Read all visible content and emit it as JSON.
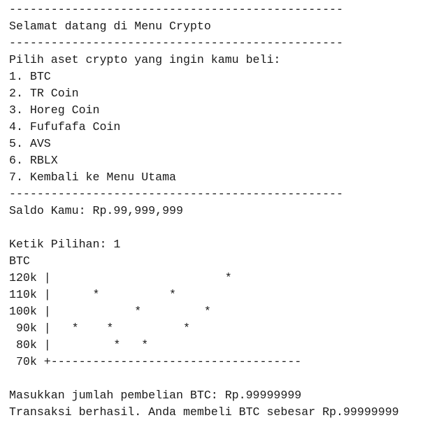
{
  "terminal": {
    "lines": [
      "------------------------------------------------",
      "Selamat datang di Menu Crypto",
      "------------------------------------------------",
      "Pilih aset crypto yang ingin kamu beli:",
      "1. BTC",
      "2. TR Coin",
      "3. Horeg Coin",
      "4. Fufufafa Coin",
      "5. AVS",
      "6. RBLX",
      "7. Kembali ke Menu Utama",
      "------------------------------------------------",
      "Saldo Kamu: Rp.99,999,999",
      "",
      "Ketik Pilihan: 1",
      "BTC",
      "120k |                         *",
      "110k |      *          *",
      "100k |            *         *",
      " 90k |   *    *          *",
      " 80k |         *   *",
      " 70k +------------------------------------",
      "",
      "Masukkan jumlah pembelian BTC: Rp.99999999",
      "Transaksi berhasil. Anda membeli BTC sebesar Rp.99999999"
    ]
  }
}
